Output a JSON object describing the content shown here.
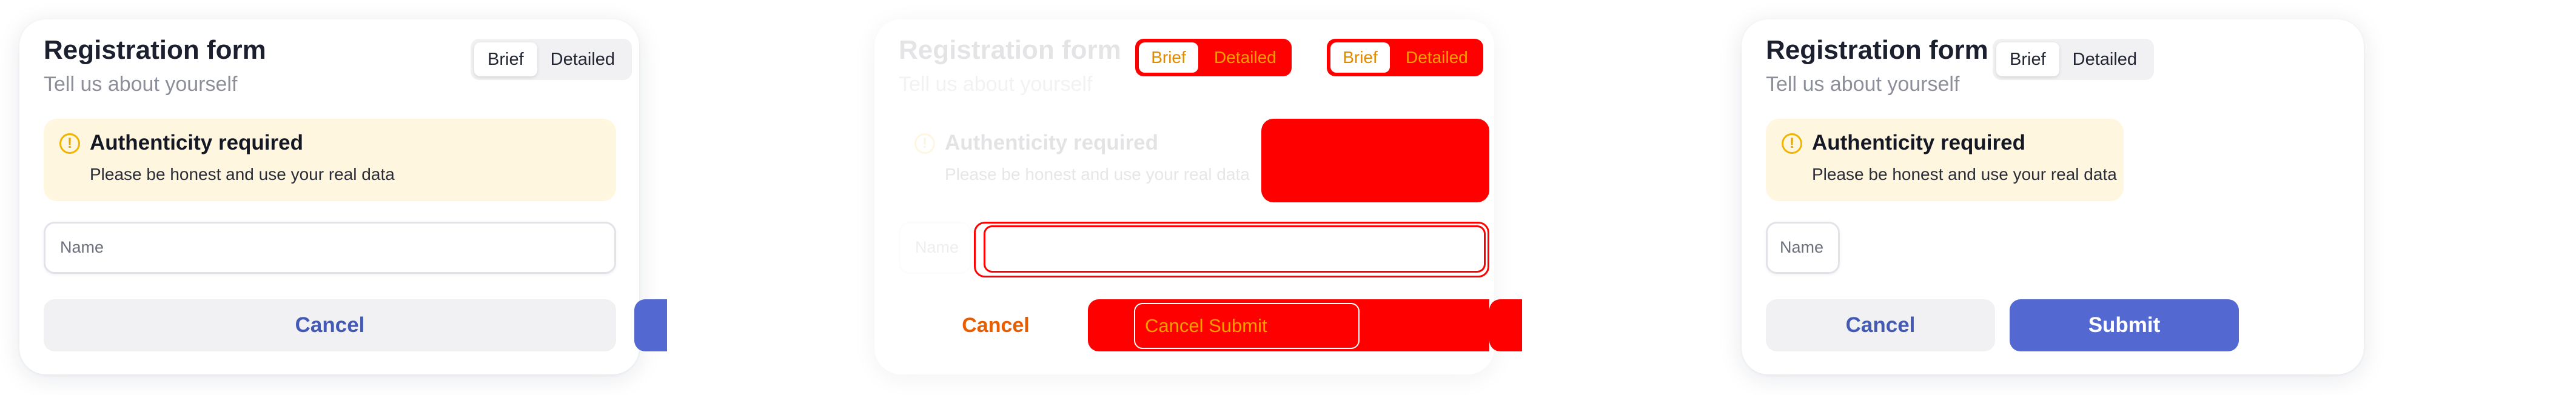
{
  "form": {
    "title": "Registration form",
    "subtitle": "Tell us about yourself",
    "toggle": {
      "brief": "Brief",
      "detailed": "Detailed"
    },
    "alert": {
      "icon": "warning-circle-icon",
      "title": "Authenticity required",
      "text": "Please be honest and use your real data"
    },
    "name_placeholder": "Name",
    "cancel_label": "Cancel",
    "submit_label": "Submit"
  },
  "overlay": {
    "buttons_label": "Cancel Submit"
  },
  "colors": {
    "accent": "#5369d1",
    "cancel_text": "#4359b3",
    "alert_bg": "#fff6df",
    "warning": "#f0b400",
    "overlay_red": "#ff0000",
    "overlay_text": "#ff9d00"
  }
}
